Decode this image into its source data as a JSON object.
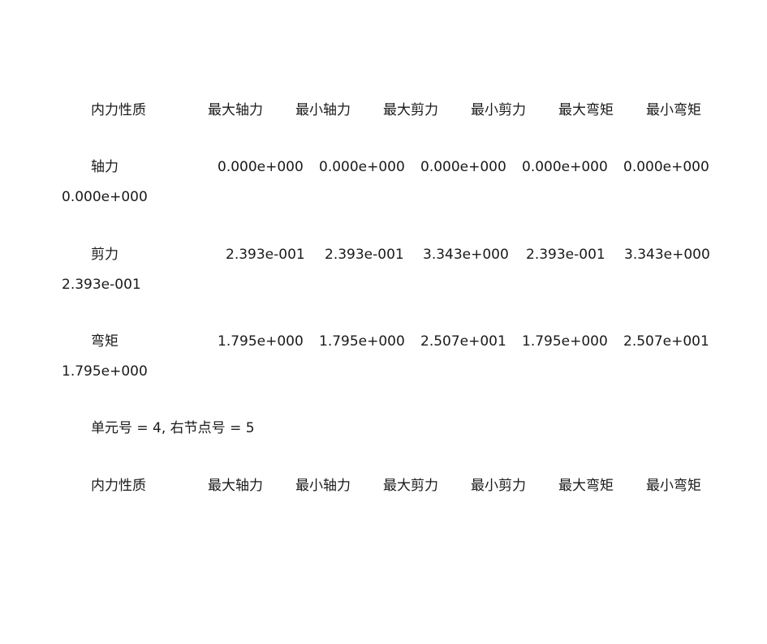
{
  "table1": {
    "header": [
      "内力性质",
      "最大轴力",
      "最小轴力",
      "最大剪力",
      "最小剪力",
      "最大弯矩",
      "最小弯矩"
    ],
    "rows": [
      {
        "label": "轴力",
        "values": [
          "0.000e+000",
          "0.000e+000",
          "0.000e+000",
          "0.000e+000",
          "0.000e+000"
        ],
        "wrapped_value": "0.000e+000"
      },
      {
        "label": "剪力",
        "values": [
          "2.393e-001",
          "2.393e-001",
          "3.343e+000",
          "2.393e-001",
          "3.343e+000"
        ],
        "wrapped_value": "2.393e-001"
      },
      {
        "label": "弯矩",
        "values": [
          "1.795e+000",
          "1.795e+000",
          "2.507e+001",
          "1.795e+000",
          "2.507e+001"
        ],
        "wrapped_value": "1.795e+000"
      }
    ]
  },
  "element_line": "单元号  = 4,  右节点号  = 5",
  "table2": {
    "header": [
      "内力性质",
      "最大轴力",
      "最小轴力",
      "最大剪力",
      "最小剪力",
      "最大弯矩",
      "最小弯矩"
    ]
  }
}
